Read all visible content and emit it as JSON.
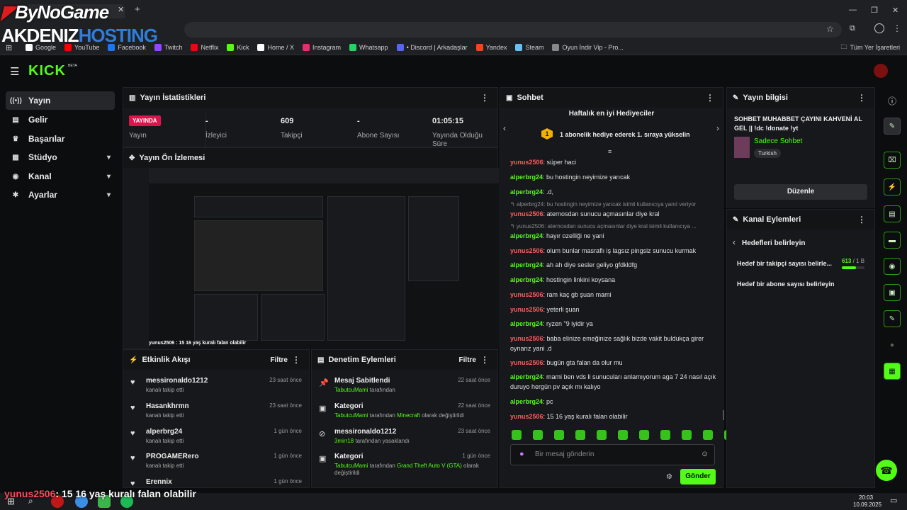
{
  "watermark": {
    "line1": "ByNoGame",
    "line2a": "AKDENIZ",
    "line2b": "HOSTING"
  },
  "browser": {
    "bookmarks": [
      {
        "label": "Google",
        "color": "#ffffff"
      },
      {
        "label": "YouTube",
        "color": "#ff0000"
      },
      {
        "label": "Facebook",
        "color": "#1877f2"
      },
      {
        "label": "Twitch",
        "color": "#9146ff"
      },
      {
        "label": "Netflix",
        "color": "#e50914"
      },
      {
        "label": "Kick",
        "color": "#53fc18"
      },
      {
        "label": "Home / X",
        "color": "#ffffff"
      },
      {
        "label": "Instagram",
        "color": "#e1306c"
      },
      {
        "label": "Whatsapp",
        "color": "#25d366"
      },
      {
        "label": "• Discord | Arkadaşlar",
        "color": "#5865f2"
      },
      {
        "label": "Yandex",
        "color": "#fc3f1d"
      },
      {
        "label": "Steam",
        "color": "#66c0f4"
      },
      {
        "label": "Oyun İndir Vip - Pro...",
        "color": "#888888"
      }
    ],
    "all_bookmarks": "Tüm Yer İşaretleri"
  },
  "kick": {
    "logo": "KICK",
    "beta": "BETA"
  },
  "sidebar": {
    "items": [
      {
        "label": "Yayın",
        "icon": "((•))"
      },
      {
        "label": "Gelir",
        "icon": "▤"
      },
      {
        "label": "Başarılar",
        "icon": "♛"
      },
      {
        "label": "Stüdyo",
        "icon": "▦"
      },
      {
        "label": "Kanal",
        "icon": "◉"
      },
      {
        "label": "Ayarlar",
        "icon": "✱"
      }
    ]
  },
  "stats": {
    "title": "Yayın İstatistikleri",
    "live_badge": "YAYINDA",
    "items": [
      {
        "value": "",
        "label": "Yayın"
      },
      {
        "value": "-",
        "label": "İzleyici"
      },
      {
        "value": "609",
        "label": "Takipçi"
      },
      {
        "value": "-",
        "label": "Abone Sayısı"
      },
      {
        "value": "01:05:15",
        "label": "Yayında Olduğu Süre"
      }
    ]
  },
  "preview": {
    "title": "Yayın Ön İzlemesi",
    "caption": "yunus2506 : 15 16 yaş kuralı falan olabilir"
  },
  "activity": {
    "title": "Etkinlik Akışı",
    "filter": "Filtre",
    "rows": [
      {
        "name": "messironaldo1212",
        "sub": "kanalı takip etti",
        "time": "23 saat önce"
      },
      {
        "name": "Hasankhrmn",
        "sub": "kanalı takip etti",
        "time": "23 saat önce"
      },
      {
        "name": "alperbrg24",
        "sub": "kanalı takip etti",
        "time": "1 gün önce"
      },
      {
        "name": "PROGAMERero",
        "sub": "kanalı takip etti",
        "time": "1 gün önce"
      },
      {
        "name": "Erennix",
        "sub": "",
        "time": "1 gün önce"
      }
    ]
  },
  "moderation": {
    "title": "Denetim Eylemleri",
    "filter": "Filtre",
    "rows": [
      {
        "title": "Mesaj Sabitlendi",
        "actor": "TabutcuMami",
        "rest": " tarafından",
        "extra": "",
        "extra2": "",
        "time": "22 saat önce",
        "icon": "📌"
      },
      {
        "title": "Kategori",
        "actor": "TabutcuMami",
        "rest": " tarafından ",
        "extra": "Minecraft",
        "extra2": " olarak değiştirildi",
        "time": "22 saat önce",
        "icon": "▣"
      },
      {
        "title": "messironaldo1212",
        "actor": "3mirr18",
        "rest": " tarafından yasaklandı",
        "extra": "",
        "extra2": "",
        "time": "23 saat önce",
        "icon": "⊘"
      },
      {
        "title": "Kategori",
        "actor": "TabutcuMami",
        "rest": " tarafından ",
        "extra": "Grand Theft Auto V (GTA)",
        "extra2": " olarak değiştirildi",
        "time": "1 gün önce",
        "icon": "▣"
      }
    ]
  },
  "chat": {
    "title": "Sohbet",
    "top_gifters": "Haftalık en iyi Hediyeciler",
    "gift_rank": "1",
    "gift_text": "1 abonelik hediye ederek 1. sıraya yükselin",
    "messages": [
      {
        "user": "yunus2506",
        "text": ": süper haci",
        "kind": "u1"
      },
      {
        "user": "alperbrg24",
        "text": ": bu hostingin neyimize yarıcak",
        "kind": "u2"
      },
      {
        "user": "alperbrg24",
        "text": ": .d,",
        "kind": "u2"
      },
      {
        "user": "",
        "text": "↰ alperbrg24: bu hostingin neyimize yarıcak isimli kullanıcıya yanıt veriyor",
        "kind": "sys"
      },
      {
        "user": "yunus2506",
        "text": ": aternosdan sunucu açmasınlar diye kral",
        "kind": "u1"
      },
      {
        "user": "",
        "text": "↰ yunus2506: aternosdan sunucu açmasınlar diye kral isimli kullanıcıya ...",
        "kind": "sys"
      },
      {
        "user": "alperbrg24",
        "text": ": hayır ozelliği ne yani",
        "kind": "u2"
      },
      {
        "user": "yunus2506",
        "text": ": olum bunlar masraflı iş lagsız pingsiz sunucu kurmak",
        "kind": "u1"
      },
      {
        "user": "alperbrg24",
        "text": ": ah ah diye sesler geliyo gfdkldfg",
        "kind": "u2"
      },
      {
        "user": "alperbrg24",
        "text": ": hostingin linkini koysana",
        "kind": "u2"
      },
      {
        "user": "yunus2506",
        "text": ": ram kaç gb şuan mami",
        "kind": "u1"
      },
      {
        "user": "yunus2506",
        "text": ": yeterli şuan",
        "kind": "u1"
      },
      {
        "user": "alperbrg24",
        "text": ": ryzen \"9 iyidir ya",
        "kind": "u2"
      },
      {
        "user": "yunus2506",
        "text": ": baba elinize emeğinize sağlık bizde vakit buldukça girer oynarız yani .d",
        "kind": "u1"
      },
      {
        "user": "yunus2506",
        "text": ": bugün gta falan da olur mu",
        "kind": "u1"
      },
      {
        "user": "alperbrg24",
        "text": ": mami ben vds li sunucuları anlamıyorum aga 7 24 nasıl açık duruyo hergün pv açık mı kalıyo",
        "kind": "u2"
      },
      {
        "user": "alperbrg24",
        "text": ": pc",
        "kind": "u2"
      },
      {
        "user": "yunus2506",
        "text": ": 15 16 yaş kuralı falan olabilir",
        "kind": "u1"
      }
    ],
    "input_placeholder": "Bir mesaj gönderin",
    "send": "Gönder"
  },
  "stream_info": {
    "title": "Yayın bilgisi",
    "stream_title": "SOHBET MUHABBET ÇAYINI KAHVENİ AL GEL || !dc !donate !yt",
    "category": "Sadece Sohbet",
    "tag": "Turkish",
    "edit": "Düzenle"
  },
  "channel_actions": {
    "title": "Kanal Eylemleri",
    "back": "Hedefleri belirleyin",
    "goal1": "Hedef bir takipçi sayısı belirle...",
    "goal1_progress": "613",
    "goal1_target": " / 1 B",
    "goal1_fraction": 0.61,
    "goal2": "Hedef bir abone sayısı belirleyin"
  },
  "taskbar": {
    "time": "20:03",
    "date": "10.09.2025"
  },
  "colors": {
    "accent": "#53fc18",
    "live": "#e0144c",
    "user_red": "#ff5c5c"
  }
}
